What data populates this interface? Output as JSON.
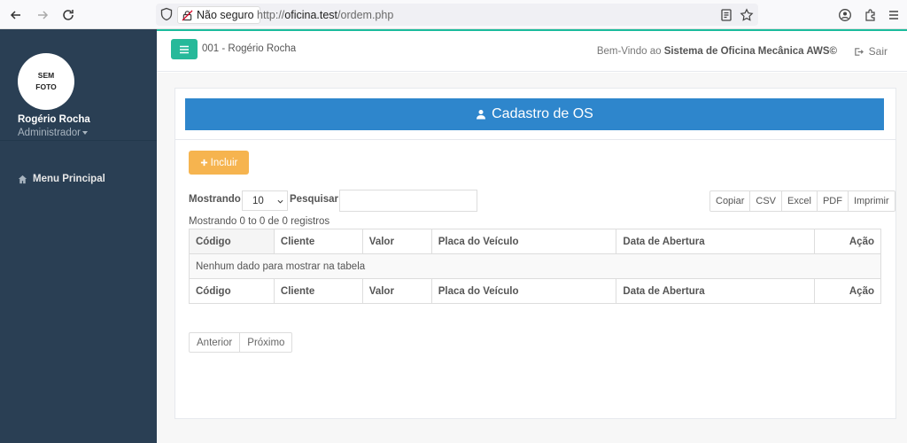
{
  "browser": {
    "security_label": "Não seguro",
    "url_prefix": "http://",
    "url_host": "oficina.test",
    "url_path": "/ordem.php"
  },
  "sidebar": {
    "avatar_line1": "SEM",
    "avatar_line2": "FOTO",
    "user_name": "Rogério Rocha",
    "user_role": "Administrador",
    "menu_items": [
      {
        "label": "Menu Principal",
        "icon": "home-icon"
      }
    ]
  },
  "header": {
    "user_label": "001 - Rogério Rocha",
    "welcome_prefix": "Bem-Vindo ao",
    "system_name": "Sistema de Oficina Mecânica AWS©",
    "logout_label": "Sair"
  },
  "panel": {
    "title": "Cadastro de OS",
    "include_label": "Incluir"
  },
  "datatable": {
    "length_label": "Mostrando",
    "length_value": "10",
    "search_label": "Pesquisar:",
    "search_value": "",
    "export_buttons": [
      "Copiar",
      "CSV",
      "Excel",
      "PDF",
      "Imprimir"
    ],
    "info_text": "Mostrando 0 to 0 de 0 registros",
    "columns": [
      "Código",
      "Cliente",
      "Valor",
      "Placa do Veículo",
      "Data de Abertura",
      "Ação"
    ],
    "empty_message": "Nenhum dado para mostrar na tabela",
    "prev_label": "Anterior",
    "next_label": "Próximo"
  },
  "colors": {
    "sidebar_bg": "#2a3f54",
    "accent_green": "#26b99a",
    "title_blue": "#2e86cc",
    "include_orange": "#f6b44f"
  }
}
